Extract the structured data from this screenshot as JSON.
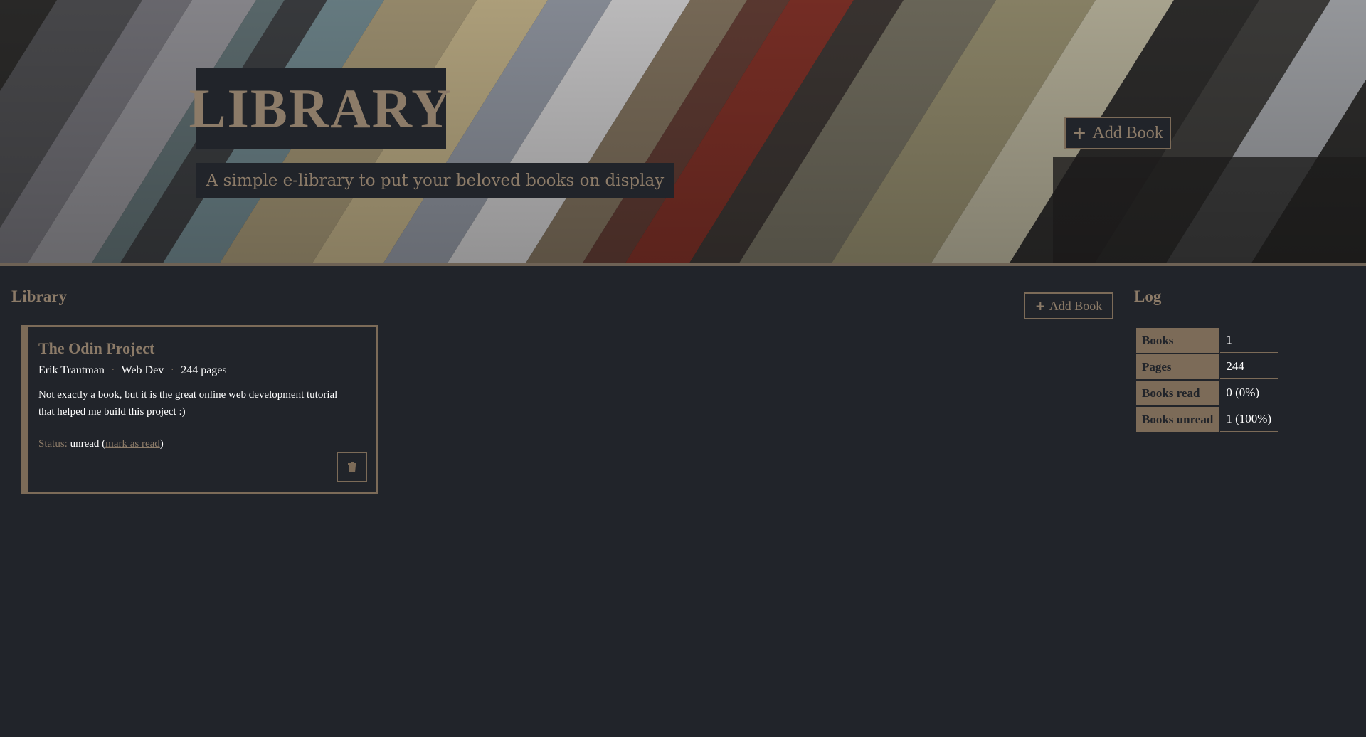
{
  "hero": {
    "logo": "LIBRARY",
    "tagline": "A simple e-library to put your beloved books on display",
    "add_button_label": "Add Book"
  },
  "main": {
    "library_heading": "Library",
    "add_button_label": "Add Book",
    "books": [
      {
        "title": "The Odin Project",
        "author": "Erik Trautman",
        "genre": "Web Dev",
        "pages": "244 pages",
        "description": "Not exactly a book, but it is the great online web development tutorial that helped me build this project :)",
        "status_label": "Status:",
        "status_value": "unread",
        "mark_link": "mark as read"
      }
    ]
  },
  "log": {
    "heading": "Log",
    "rows": [
      {
        "label": "Books",
        "value": "1"
      },
      {
        "label": "Pages",
        "value": "244"
      },
      {
        "label": "Books read",
        "value": "0 (0%)"
      },
      {
        "label": "Books unread",
        "value": "1 (100%)"
      }
    ]
  },
  "colors": {
    "background": "#21242a",
    "accent": "#8c7b68",
    "border": "#7c6b58"
  },
  "icons": [
    "plus-icon",
    "trash-icon"
  ]
}
